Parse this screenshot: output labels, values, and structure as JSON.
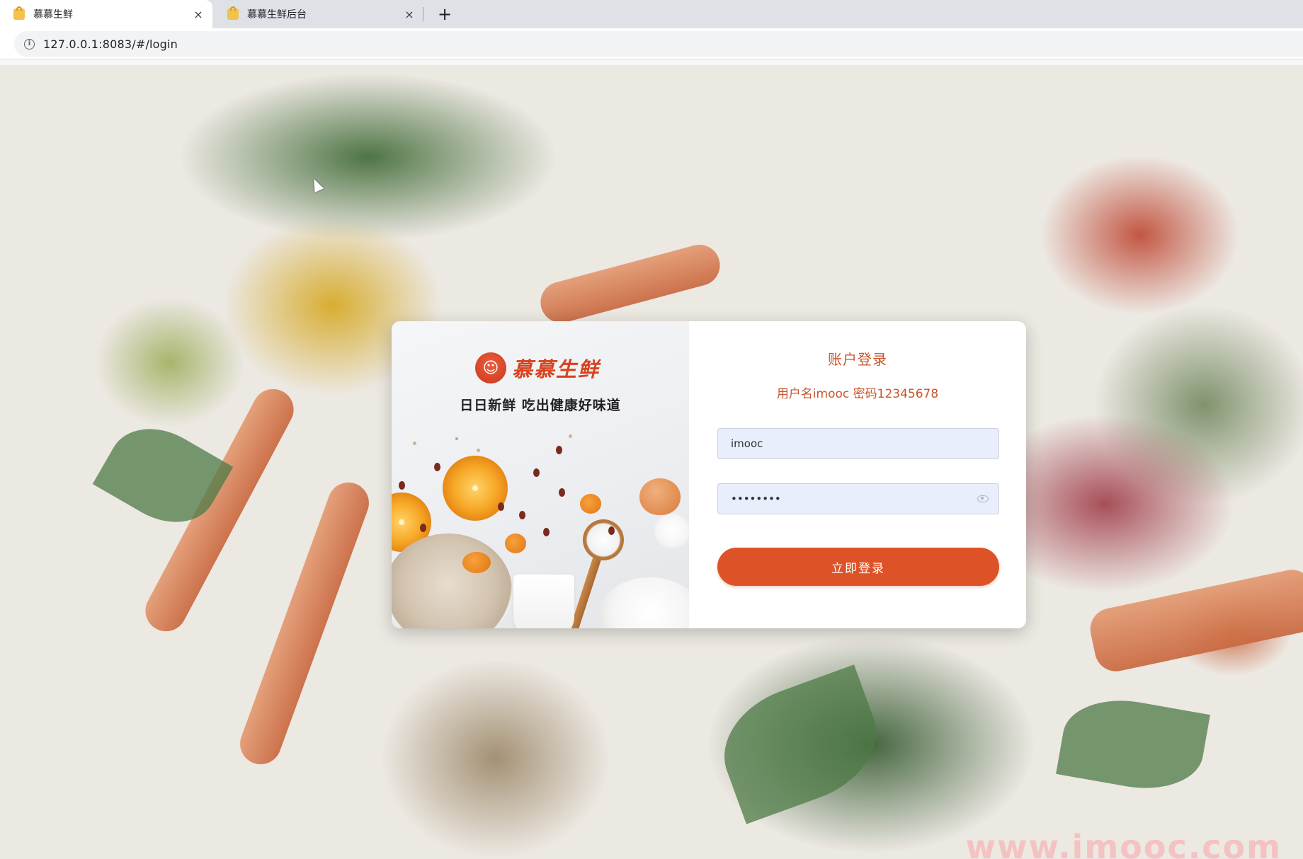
{
  "browser": {
    "tabs": [
      {
        "title": "慕慕生鲜",
        "active": true
      },
      {
        "title": "慕慕生鲜后台",
        "active": false
      }
    ],
    "close_glyph": "×",
    "new_tab_glyph": "+",
    "url": "127.0.0.1:8083/#/login",
    "info_glyph": "i"
  },
  "promo": {
    "brand_name": "慕慕生鲜",
    "logo_glyph": "☺",
    "slogan": "日日新鲜  吃出健康好味道"
  },
  "login": {
    "title": "账户登录",
    "hint": "用户名imooc 密码12345678",
    "username_value": "imooc",
    "password_value": "••••••••",
    "submit_label": "立即登录"
  },
  "page": {
    "watermark": "www.imooc.com"
  },
  "colors": {
    "accent": "#de5227",
    "brand_red": "#d8421f",
    "input_bg": "#e8eefc"
  }
}
